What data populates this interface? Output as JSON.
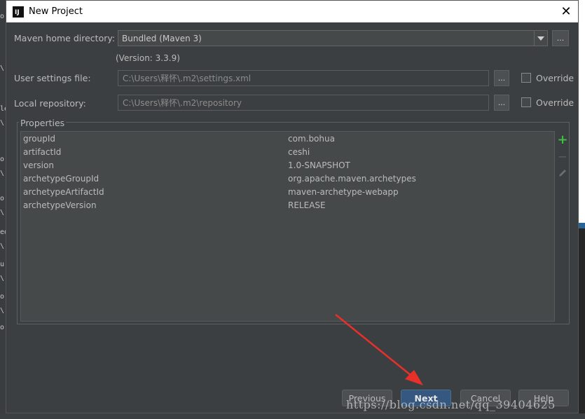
{
  "window": {
    "title": "New Project",
    "close_glyph": "✕",
    "icon_text": "IJ"
  },
  "maven": {
    "home_label": "Maven home directory:",
    "home_value": "Bundled (Maven 3)",
    "version_text": "(Version: 3.3.9)",
    "settings_label": "User settings file:",
    "settings_value": "C:\\Users\\释怀\\.m2\\settings.xml",
    "repo_label": "Local repository:",
    "repo_value": "C:\\Users\\释怀\\.m2\\repository",
    "browse_label": "...",
    "override_label": "Override"
  },
  "properties": {
    "title": "Properties",
    "rows": [
      {
        "key": "groupId",
        "value": "com.bohua"
      },
      {
        "key": "artifactId",
        "value": "ceshi"
      },
      {
        "key": "version",
        "value": "1.0-SNAPSHOT"
      },
      {
        "key": "archetypeGroupId",
        "value": "org.apache.maven.archetypes"
      },
      {
        "key": "archetypeArtifactId",
        "value": "maven-archetype-webapp"
      },
      {
        "key": "archetypeVersion",
        "value": "RELEASE"
      }
    ],
    "tools": {
      "add": "+",
      "remove": "−"
    }
  },
  "buttons": {
    "previous": "Previous",
    "next": "Next",
    "cancel": "Cancel",
    "help": "Help"
  },
  "watermark": "https://blog.csdn.net/qq_39404625",
  "background_fragments": [
    "o",
    "\\",
    "le",
    "\\",
    "o",
    "\\",
    "o",
    "\\",
    "ed",
    "\\",
    "u",
    "\\",
    "o",
    "\\",
    "o"
  ],
  "colors": {
    "dialog_bg": "#3c3f41",
    "primary_button": "#365880",
    "add_icon": "#3fbf3f",
    "annotation_arrow": "#e8302b"
  }
}
